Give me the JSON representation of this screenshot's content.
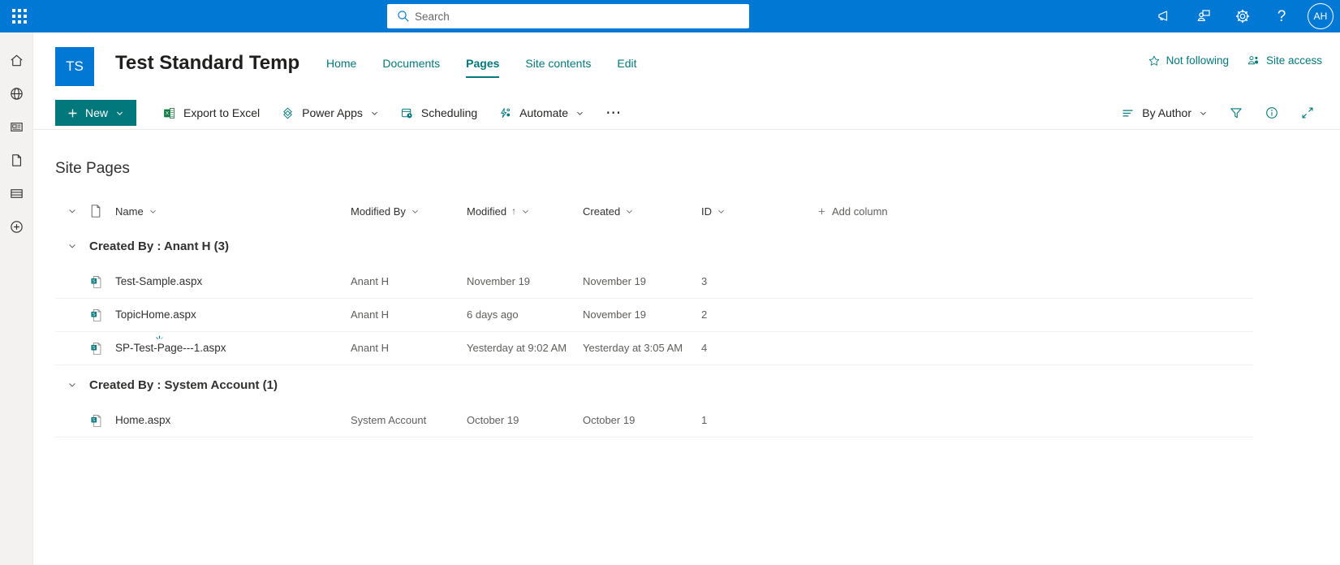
{
  "suite_bar": {
    "waffle_icon": "app-launcher-icon",
    "search": {
      "placeholder": "Search",
      "value": "",
      "icon": "search-icon"
    },
    "actions": [
      {
        "name": "announcements-button",
        "icon": "megaphone-icon"
      },
      {
        "name": "feedback-button",
        "icon": "chat-bubbles-icon"
      },
      {
        "name": "settings-button",
        "icon": "gear-icon"
      },
      {
        "name": "help-button",
        "icon": "question-mark-icon",
        "glyph": "?"
      }
    ],
    "avatar": {
      "initials": "AH",
      "name": "user-avatar"
    },
    "background_color": "#0078d4"
  },
  "rail": {
    "items": [
      {
        "name": "sidebar-item-home",
        "icon": "home-icon"
      },
      {
        "name": "sidebar-item-globe",
        "icon": "globe-icon"
      },
      {
        "name": "sidebar-item-news",
        "icon": "news-icon"
      },
      {
        "name": "sidebar-item-files",
        "icon": "document-icon"
      },
      {
        "name": "sidebar-item-lists",
        "icon": "list-icon"
      },
      {
        "name": "sidebar-item-create",
        "icon": "plus-circle-icon"
      }
    ]
  },
  "site_header": {
    "logo_initials": "TS",
    "logo_color": "#0078d4",
    "title": "Test Standard Temp",
    "nav": [
      {
        "label": "Home",
        "active": false
      },
      {
        "label": "Documents",
        "active": false
      },
      {
        "label": "Pages",
        "active": true
      },
      {
        "label": "Site contents",
        "active": false
      },
      {
        "label": "Edit",
        "active": false
      }
    ],
    "following_label": "Not following",
    "following_icon": "star-outline-icon",
    "site_access_label": "Site access",
    "site_access_icon": "people-icon",
    "accent_color": "#03787c"
  },
  "command_bar": {
    "new_button": {
      "label": "New",
      "icon": "plus-icon",
      "chevron": "chevron-down-icon",
      "color": "#03787c"
    },
    "buttons": [
      {
        "label": "Export to Excel",
        "icon": "excel-icon",
        "chevron": false
      },
      {
        "label": "Power Apps",
        "icon": "power-apps-icon",
        "chevron": true
      },
      {
        "label": "Scheduling",
        "icon": "scheduling-icon",
        "chevron": false
      },
      {
        "label": "Automate",
        "icon": "automate-icon",
        "chevron": true
      }
    ],
    "overflow_label": "⋯",
    "view_selector": {
      "label": "By Author",
      "icon": "list-view-icon",
      "chevron": "chevron-down-icon"
    },
    "right_icons": [
      {
        "name": "filter-button",
        "icon": "filter-funnel-icon"
      },
      {
        "name": "info-button",
        "icon": "info-circle-icon"
      },
      {
        "name": "expand-button",
        "icon": "expand-diagonal-icon"
      }
    ]
  },
  "main": {
    "page_title": "Site Pages",
    "columns": [
      {
        "label": "Name",
        "sort": "",
        "chevron": true
      },
      {
        "label": "Modified By",
        "sort": "",
        "chevron": true
      },
      {
        "label": "Modified",
        "sort": "↑",
        "chevron": true
      },
      {
        "label": "Created",
        "sort": "",
        "chevron": true
      },
      {
        "label": "ID",
        "sort": "",
        "chevron": true
      }
    ],
    "add_column_label": "Add column",
    "add_column_icon": "plus-icon",
    "file_type_icon": "document-header-icon",
    "groups": [
      {
        "label": "Created By : Anant H (3)",
        "expanded": true,
        "rows": [
          {
            "icon": "sharepoint-page-icon",
            "name": "Test-Sample.aspx",
            "modified_by": "Anant H",
            "modified": "November 19",
            "created": "November 19",
            "id": "3"
          },
          {
            "icon": "sharepoint-page-icon",
            "name": "TopicHome.aspx",
            "modified_by": "Anant H",
            "modified": "6 days ago",
            "created": "November 19",
            "id": "2"
          },
          {
            "icon": "sharepoint-page-icon",
            "name": "SP-Test-Page---1.aspx",
            "modified_by": "Anant H",
            "modified": "Yesterday at 9:02 AM",
            "created": "Yesterday at 3:05 AM",
            "id": "4"
          }
        ]
      },
      {
        "label": "Created By : System Account (1)",
        "expanded": true,
        "rows": [
          {
            "icon": "sharepoint-page-icon",
            "name": "Home.aspx",
            "modified_by": "System Account",
            "modified": "October 19",
            "created": "October 19",
            "id": "1"
          }
        ]
      }
    ]
  }
}
